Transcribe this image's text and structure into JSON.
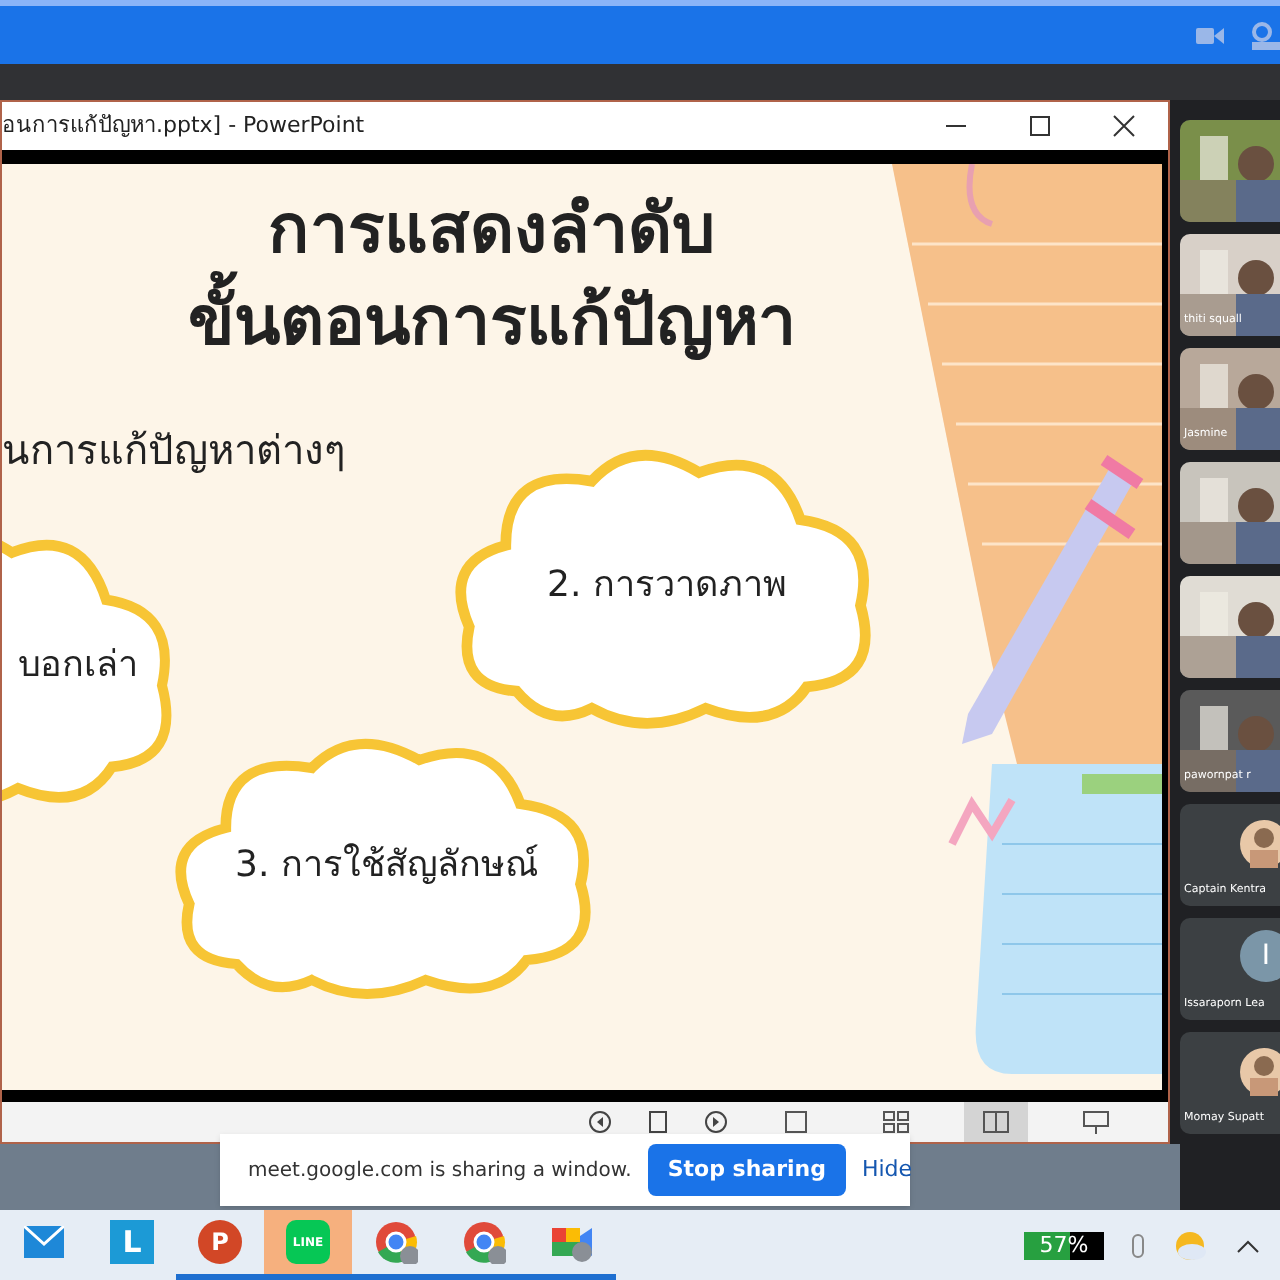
{
  "window": {
    "title": "อนการแก้ปัญหา.pptx] - PowerPoint"
  },
  "slide": {
    "title_lines": [
      "การแสดงลำดับ",
      "ขั้นตอนการแก้ปัญหา"
    ],
    "subtitle": "นการแก้ปัญหาต่างๆ",
    "clouds": [
      {
        "kind": "left",
        "text": "บอกเล่า"
      },
      {
        "kind": "right",
        "text": "2. การวาดภาพ"
      },
      {
        "kind": "bottom",
        "text": "3. การใช้สัญลักษณ์"
      }
    ]
  },
  "status_bar": {
    "views": [
      {
        "kind": "normal",
        "selected": false
      },
      {
        "kind": "sorter",
        "selected": false
      },
      {
        "kind": "reading",
        "selected": true
      },
      {
        "kind": "show",
        "selected": false
      }
    ]
  },
  "participants": [
    {
      "kind": "picture"
    },
    {
      "kind": "picture",
      "name": "thiti squall"
    },
    {
      "kind": "picture",
      "name": "Jasmine"
    },
    {
      "kind": "picture"
    },
    {
      "kind": "picture"
    },
    {
      "kind": "picture",
      "name": "pawornpat r"
    },
    {
      "kind": "avatar",
      "name": "Captain Kentra"
    },
    {
      "kind": "letter",
      "letter": "I",
      "name": "Issaraporn Lea"
    },
    {
      "kind": "avatar",
      "name": "Momay Supatt"
    }
  ],
  "sharing_bar": {
    "message": "meet.google.com is sharing a window.",
    "stop_button": "Stop sharing",
    "hide_button": "Hide"
  },
  "taskbar": {
    "apps": [
      {
        "kind": "mail",
        "active": false
      },
      {
        "kind": "letter",
        "glyph": "L",
        "active": false
      },
      {
        "kind": "powerpoint",
        "glyph": "P",
        "active": true
      },
      {
        "kind": "line",
        "glyph": "LINE",
        "active": true
      },
      {
        "kind": "chrome",
        "active": true
      },
      {
        "kind": "chrome",
        "active": true
      },
      {
        "kind": "meet",
        "active": true
      }
    ],
    "battery": {
      "text": "57%",
      "level": 0.57
    }
  }
}
